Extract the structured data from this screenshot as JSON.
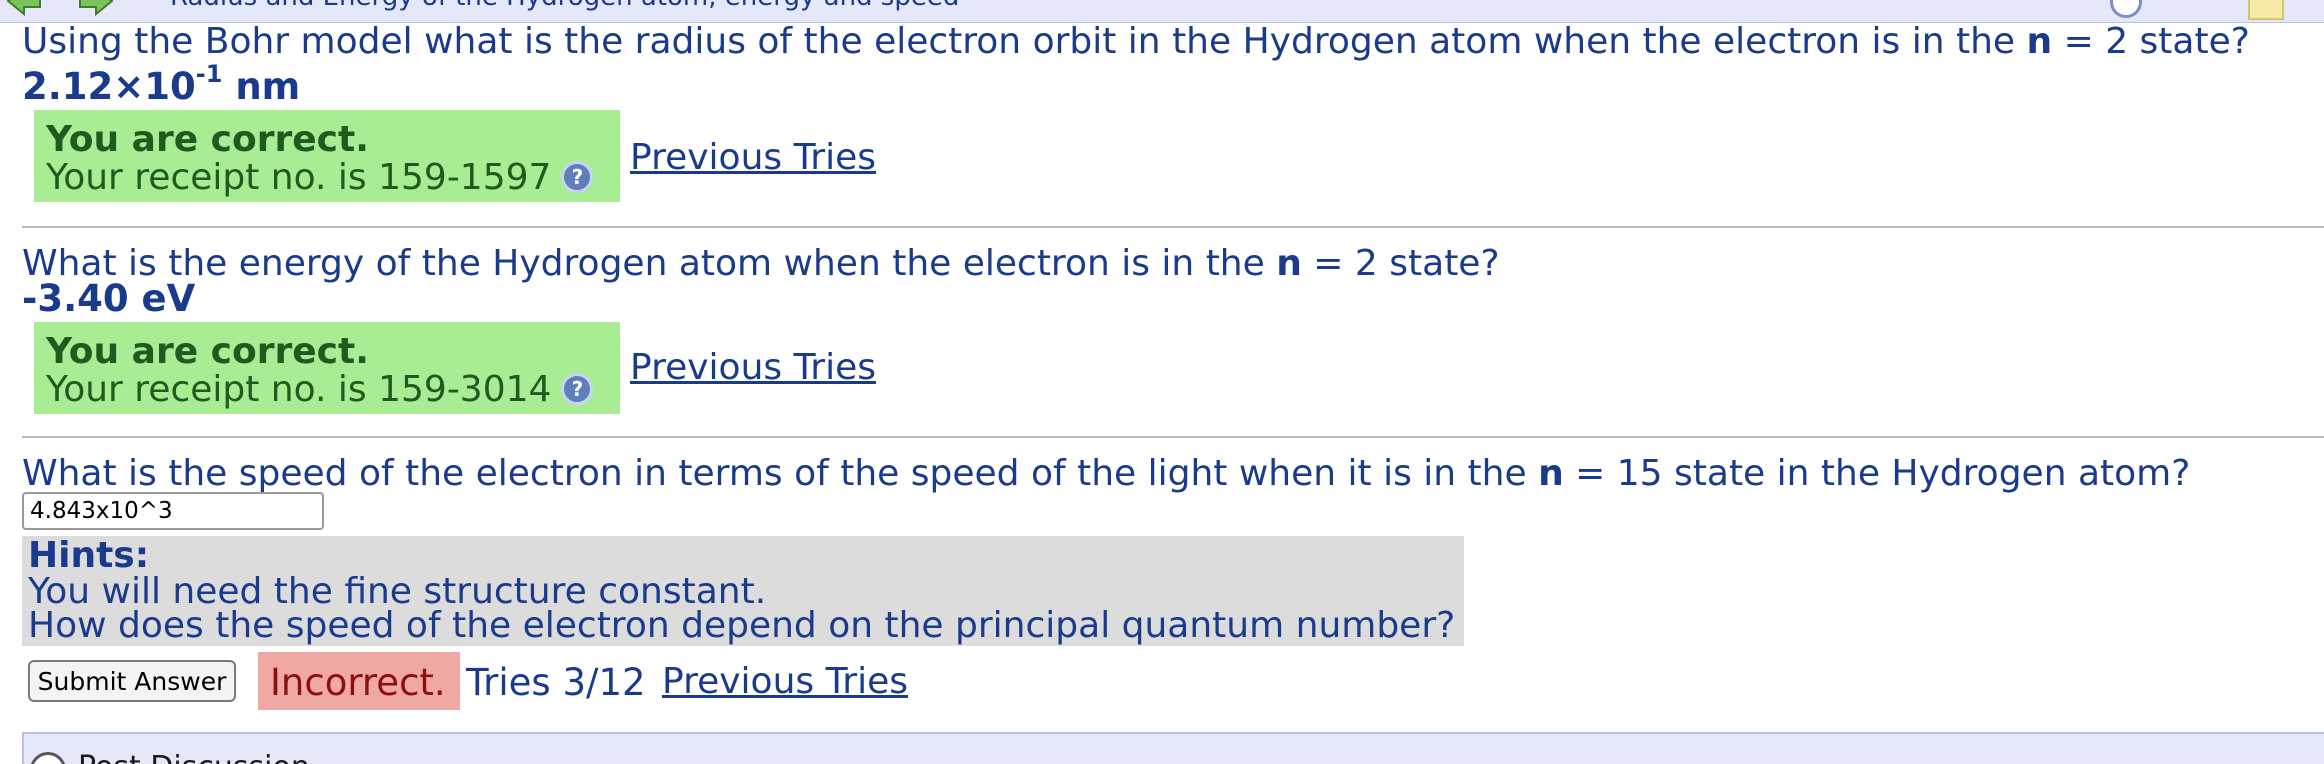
{
  "topbar": {
    "title": "Radius and Energy of the Hydrogen atom, energy and speed"
  },
  "questions": [
    {
      "prompt_before": "Using the Bohr model what is the radius of the electron orbit in the Hydrogen atom when the electron is in the ",
      "prompt_var": "n",
      "prompt_after": " = 2 state?",
      "answer_mantissa": "2.12×10",
      "answer_exponent": "-1",
      "answer_unit": " nm",
      "status_title": "You are correct.",
      "receipt_text": "Your receipt no. is 159-1597",
      "previous_tries": "Previous Tries"
    },
    {
      "prompt_before": "What is the energy of the Hydrogen atom when the electron is in the ",
      "prompt_var": "n",
      "prompt_after": " = 2 state?",
      "answer": "-3.40 eV",
      "status_title": "You are correct.",
      "receipt_text": "Your receipt no. is 159-3014",
      "previous_tries": "Previous Tries"
    },
    {
      "prompt_before": "What is the speed of the electron in terms of the speed of the light when it is in the ",
      "prompt_var": "n",
      "prompt_after": " = 15 state in the Hydrogen atom?",
      "input_value": "4.843x10^3",
      "hints_title": "Hints:",
      "hints": [
        "You will need the fine structure constant.",
        "How does the speed of the electron depend on the principal quantum number?"
      ],
      "submit_label": "Submit Answer",
      "status": "Incorrect.",
      "tries": "Tries 3/12",
      "previous_tries": "Previous Tries"
    }
  ],
  "help_icon_glyph": "?",
  "footer": {
    "discussion_label": "Post Discussion"
  },
  "colors": {
    "text": "#1a3a8c",
    "correct_bg": "#a8ec94",
    "incorrect_bg": "#f0a8a4",
    "hints_bg": "#dcdcdc"
  }
}
